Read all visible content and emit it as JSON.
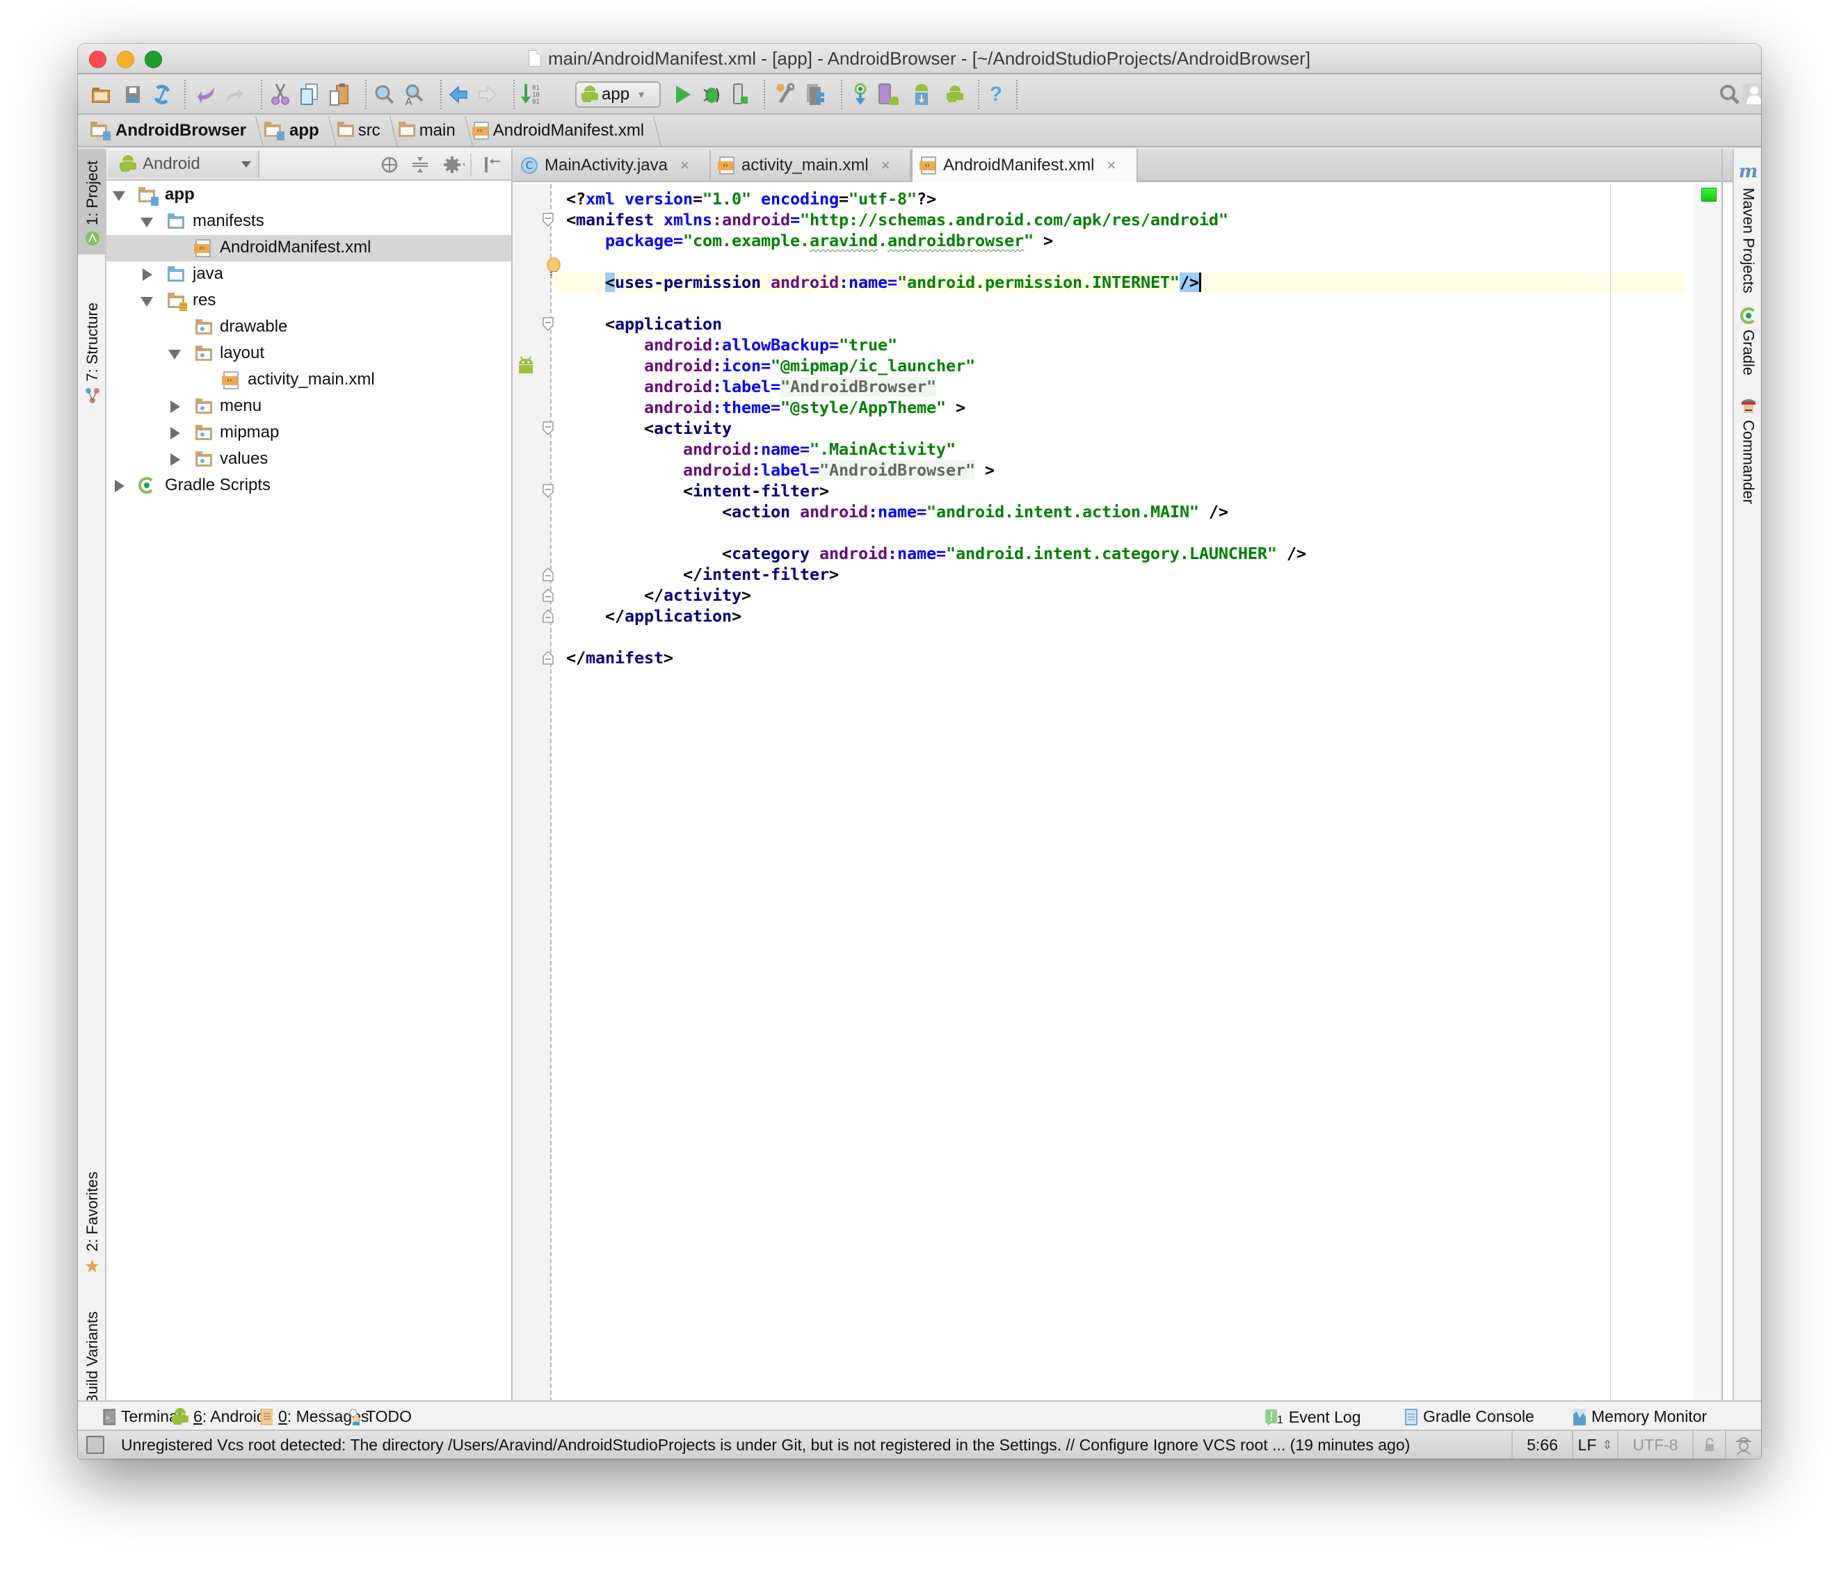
{
  "window": {
    "title": "main/AndroidManifest.xml - [app] - AndroidBrowser - [~/AndroidStudioProjects/AndroidBrowser]"
  },
  "toolbar": {
    "run_config": "app",
    "icons": [
      "open-folder-icon",
      "save-icon",
      "sync-icon",
      "undo-icon",
      "redo-icon",
      "cut-icon",
      "copy-icon",
      "paste-icon",
      "find-icon",
      "replace-icon",
      "back-icon",
      "forward-icon",
      "make-project-icon",
      "run-config-dropdown",
      "run-icon",
      "debug-icon",
      "attach-debugger-icon",
      "project-structure-icon",
      "sdk-manager-icon",
      "gradle-sync-icon",
      "avd-manager-icon",
      "sdk-download-icon",
      "android-device-monitor-icon",
      "help-icon",
      "search-everywhere-icon",
      "user-icon"
    ]
  },
  "breadcrumb": [
    {
      "label": "AndroidBrowser",
      "icon": "module-folder-icon"
    },
    {
      "label": "app",
      "icon": "module-folder-icon"
    },
    {
      "label": "src",
      "icon": "folder-icon"
    },
    {
      "label": "main",
      "icon": "folder-icon"
    },
    {
      "label": "AndroidManifest.xml",
      "icon": "xml-file-icon"
    }
  ],
  "left_strip": {
    "project": "1: Project",
    "structure": "7: Structure",
    "favorites": "2: Favorites",
    "build_variants": "Build Variants"
  },
  "right_strip": {
    "maven": "Maven Projects",
    "gradle": "Gradle",
    "commander": "Commander"
  },
  "project_panel": {
    "view_mode": "Android",
    "tree": [
      {
        "label": "app",
        "depth": 0,
        "state": "open",
        "icon": "module-folder-icon",
        "bold": true
      },
      {
        "label": "manifests",
        "depth": 1,
        "state": "open",
        "icon": "source-folder-icon"
      },
      {
        "label": "AndroidManifest.xml",
        "depth": 2,
        "state": "leaf",
        "icon": "xml-file-icon",
        "selected": true
      },
      {
        "label": "java",
        "depth": 1,
        "state": "closed",
        "icon": "source-folder-icon"
      },
      {
        "label": "res",
        "depth": 1,
        "state": "open",
        "icon": "resource-folder-icon"
      },
      {
        "label": "drawable",
        "depth": 2,
        "state": "leaf",
        "icon": "package-folder-icon"
      },
      {
        "label": "layout",
        "depth": 2,
        "state": "open",
        "icon": "package-folder-icon"
      },
      {
        "label": "activity_main.xml",
        "depth": 3,
        "state": "leaf",
        "icon": "xml-file-icon"
      },
      {
        "label": "menu",
        "depth": 2,
        "state": "closed",
        "icon": "package-folder-icon"
      },
      {
        "label": "mipmap",
        "depth": 2,
        "state": "closed",
        "icon": "package-folder-icon"
      },
      {
        "label": "values",
        "depth": 2,
        "state": "closed",
        "icon": "package-folder-icon"
      },
      {
        "label": "Gradle Scripts",
        "depth": 0,
        "state": "closed",
        "icon": "gradle-icon"
      }
    ]
  },
  "editor": {
    "tabs": [
      {
        "label": "MainActivity.java",
        "icon": "java-class-icon",
        "active": false
      },
      {
        "label": "activity_main.xml",
        "icon": "xml-file-icon",
        "active": false
      },
      {
        "label": "AndroidManifest.xml",
        "icon": "xml-file-icon",
        "active": true
      }
    ],
    "lines": [
      [
        [
          "p",
          "<?"
        ],
        [
          "a",
          "xml version"
        ],
        [
          "p",
          "="
        ],
        [
          "v",
          "\"1.0\""
        ],
        [
          "p",
          " "
        ],
        [
          "a",
          "encoding"
        ],
        [
          "p",
          "="
        ],
        [
          "v",
          "\"utf-8\""
        ],
        [
          "p",
          "?>"
        ]
      ],
      [
        [
          "p",
          "<"
        ],
        [
          "t",
          "manifest "
        ],
        [
          "a",
          "xmlns"
        ],
        [
          "ns",
          ":android"
        ],
        [
          "a",
          "="
        ],
        [
          "v",
          "\"http://schemas.android.com/apk/res/android\""
        ]
      ],
      [
        [
          "p",
          "    "
        ],
        [
          "a",
          "package"
        ],
        [
          "a",
          "="
        ],
        [
          "v",
          "\"com.example."
        ],
        [
          "vs",
          "aravind"
        ],
        [
          "v",
          "."
        ],
        [
          "vs",
          "androidbrowser"
        ],
        [
          "v",
          "\""
        ],
        [
          "p",
          " >"
        ]
      ],
      [],
      [
        [
          "p",
          "    "
        ],
        [
          "b",
          "<"
        ],
        [
          "t",
          "uses-permission "
        ],
        [
          "ns",
          "android"
        ],
        [
          "a",
          ":name="
        ],
        [
          "v",
          "\"android.permission.INTERNET\""
        ],
        [
          "b",
          "/>"
        ],
        [
          "c",
          ""
        ]
      ],
      [],
      [
        [
          "p",
          "    <"
        ],
        [
          "t",
          "application"
        ]
      ],
      [
        [
          "p",
          "        "
        ],
        [
          "ns",
          "android"
        ],
        [
          "a",
          ":allowBackup="
        ],
        [
          "v",
          "\"true\""
        ]
      ],
      [
        [
          "p",
          "        "
        ],
        [
          "ns",
          "android"
        ],
        [
          "a",
          ":icon="
        ],
        [
          "v",
          "\"@mipmap/ic_launcher\""
        ]
      ],
      [
        [
          "p",
          "        "
        ],
        [
          "ns",
          "android"
        ],
        [
          "a",
          ":label="
        ],
        [
          "vd",
          "\"AndroidBrowser\""
        ]
      ],
      [
        [
          "p",
          "        "
        ],
        [
          "ns",
          "android"
        ],
        [
          "a",
          ":theme="
        ],
        [
          "v",
          "\"@style/AppTheme\""
        ],
        [
          "p",
          " >"
        ]
      ],
      [
        [
          "p",
          "        <"
        ],
        [
          "t",
          "activity"
        ]
      ],
      [
        [
          "p",
          "            "
        ],
        [
          "ns",
          "android"
        ],
        [
          "a",
          ":name="
        ],
        [
          "v",
          "\".MainActivity\""
        ]
      ],
      [
        [
          "p",
          "            "
        ],
        [
          "ns",
          "android"
        ],
        [
          "a",
          ":label="
        ],
        [
          "vd",
          "\"AndroidBrowser\""
        ],
        [
          "p",
          " >"
        ]
      ],
      [
        [
          "p",
          "            <"
        ],
        [
          "t",
          "intent-filter"
        ],
        [
          "p",
          ">"
        ]
      ],
      [
        [
          "p",
          "                <"
        ],
        [
          "t",
          "action "
        ],
        [
          "ns",
          "android"
        ],
        [
          "a",
          ":name="
        ],
        [
          "v",
          "\"android.intent.action.MAIN\""
        ],
        [
          "p",
          " />"
        ]
      ],
      [],
      [
        [
          "p",
          "                <"
        ],
        [
          "t",
          "category "
        ],
        [
          "ns",
          "android"
        ],
        [
          "a",
          ":name="
        ],
        [
          "v",
          "\"android.intent.category.LAUNCHER\""
        ],
        [
          "p",
          " />"
        ]
      ],
      [
        [
          "p",
          "            </"
        ],
        [
          "t",
          "intent-filter"
        ],
        [
          "p",
          ">"
        ]
      ],
      [
        [
          "p",
          "        </"
        ],
        [
          "t",
          "activity"
        ],
        [
          "p",
          ">"
        ]
      ],
      [
        [
          "p",
          "    </"
        ],
        [
          "t",
          "application"
        ],
        [
          "p",
          ">"
        ]
      ],
      [],
      [
        [
          "p",
          "</"
        ],
        [
          "t",
          "manifest"
        ],
        [
          "p",
          ">"
        ]
      ]
    ],
    "fold_markers": [
      {
        "line": 2,
        "kind": "open"
      },
      {
        "line": 7,
        "kind": "open"
      },
      {
        "line": 12,
        "kind": "open"
      },
      {
        "line": 15,
        "kind": "open"
      },
      {
        "line": 19,
        "kind": "close"
      },
      {
        "line": 20,
        "kind": "close"
      },
      {
        "line": 21,
        "kind": "close"
      },
      {
        "line": 23,
        "kind": "close"
      }
    ],
    "caret_line": 5,
    "inspection_status": "ok"
  },
  "tool_windows": {
    "left": [
      {
        "key": "6",
        "label": "Terminal",
        "icon": "terminal-icon"
      },
      {
        "key": "6",
        "prefix": "6",
        "label": ": Android",
        "icon": "android-icon"
      },
      {
        "prefix": "0",
        "label": ": Messages",
        "icon": "messages-icon"
      },
      {
        "label": "TODO",
        "icon": "todo-icon"
      }
    ],
    "right": [
      {
        "label": "Event Log",
        "badge": "1",
        "icon": "event-log-icon"
      },
      {
        "label": "Gradle Console",
        "icon": "gradle-console-icon"
      },
      {
        "label": "Memory Monitor",
        "icon": "memory-monitor-icon"
      }
    ]
  },
  "status": {
    "message": "Unregistered Vcs root detected: The directory /Users/Aravind/AndroidStudioProjects is under Git, but is not registered in the Settings. // Configure  Ignore VCS root ... (19 minutes ago)",
    "position": "5:66",
    "line_separator": "LF",
    "line_separator_arrows": "⇕",
    "encoding": "UTF-8"
  },
  "colors": {
    "tag": "#000080",
    "attribute": "#0000ff",
    "namespace": "#660e7a",
    "value": "#008000",
    "caret_row": "#fffde7",
    "brace_match": "#99ccff"
  }
}
